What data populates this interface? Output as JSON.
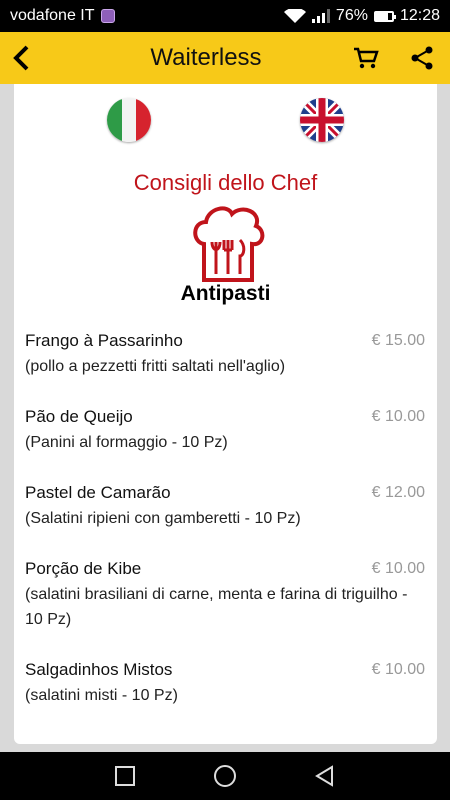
{
  "status_bar": {
    "carrier": "vodafone IT",
    "battery": "76%",
    "battery_level": 0.76,
    "time": "12:28"
  },
  "app_bar": {
    "title": "Waiterless"
  },
  "content": {
    "section_title": "Consigli dello Chef",
    "category_title": "Antipasti",
    "items": [
      {
        "name": "Frango à Passarinho",
        "price": "€ 15.00",
        "description": "(pollo a pezzetti fritti saltati nell'aglio)"
      },
      {
        "name": "Pão de Queijo",
        "price": "€ 10.00",
        "description": "(Panini al formaggio - 10 Pz)"
      },
      {
        "name": "Pastel de Camarão",
        "price": "€ 12.00",
        "description": "(Salatini ripieni con gamberetti - 10 Pz)"
      },
      {
        "name": "Porção de Kibe",
        "price": "€ 10.00",
        "description": "(salatini brasiliani di carne, menta e farina di triguilho - 10 Pz)"
      },
      {
        "name": "Salgadinhos Mistos",
        "price": "€ 10.00",
        "description": "(salatini misti - 10 Pz)"
      }
    ]
  },
  "colors": {
    "app_bar": "#f7c918",
    "accent_red": "#c0141b"
  },
  "icons": {
    "back": "back-arrow-icon",
    "cart": "cart-icon",
    "share": "share-icon",
    "chef": "chef-hat-icon"
  }
}
